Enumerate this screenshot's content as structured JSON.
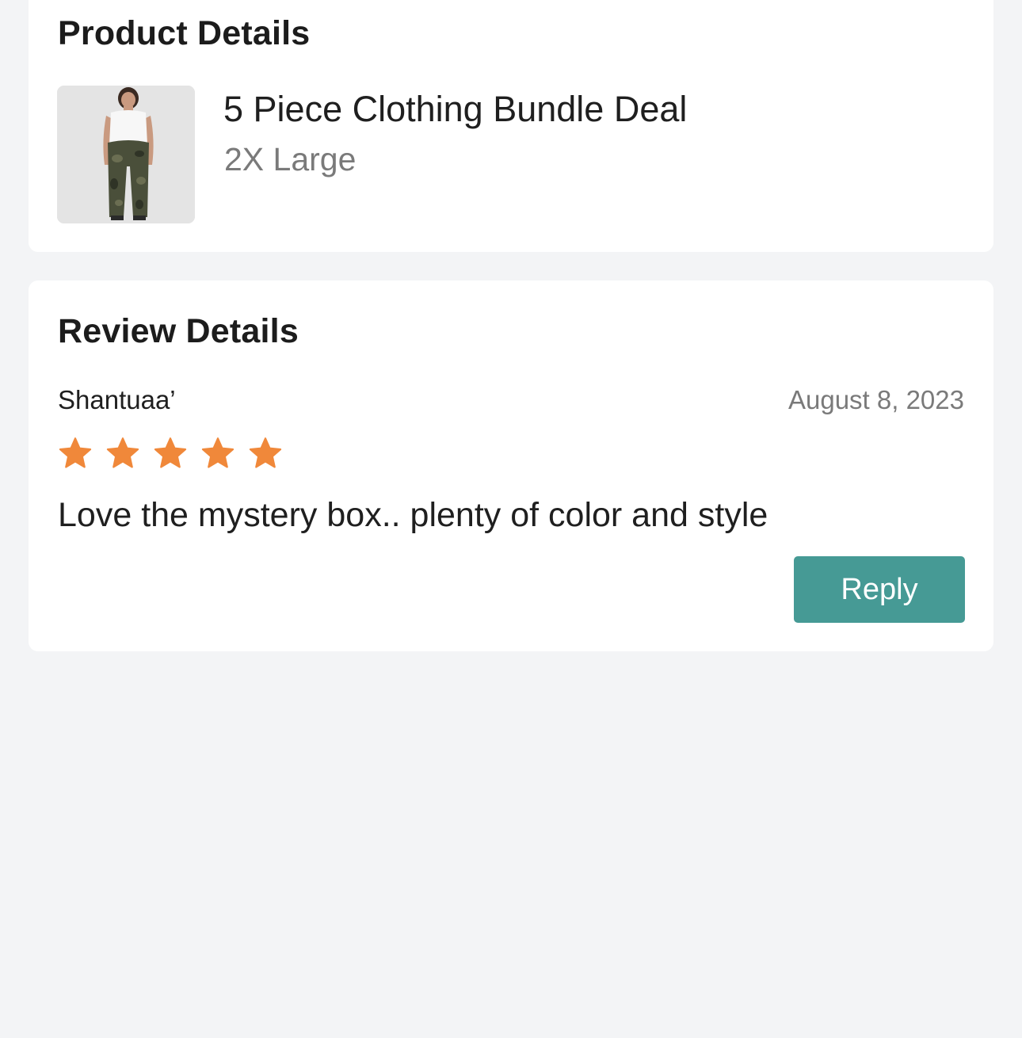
{
  "product_section": {
    "title": "Product Details",
    "product": {
      "image": "product-thumbnail",
      "name": "5 Piece Clothing Bundle Deal",
      "variant": "2X Large"
    }
  },
  "review_section": {
    "title": "Review Details",
    "reviewer_name": "Shantuaa’",
    "date": "August 8, 2023",
    "rating": 5,
    "rating_max": 5,
    "star_color": "#f0883a",
    "text": "Love the mystery box.. plenty of color and style",
    "reply_label": "Reply",
    "reply_color": "#469a95"
  }
}
